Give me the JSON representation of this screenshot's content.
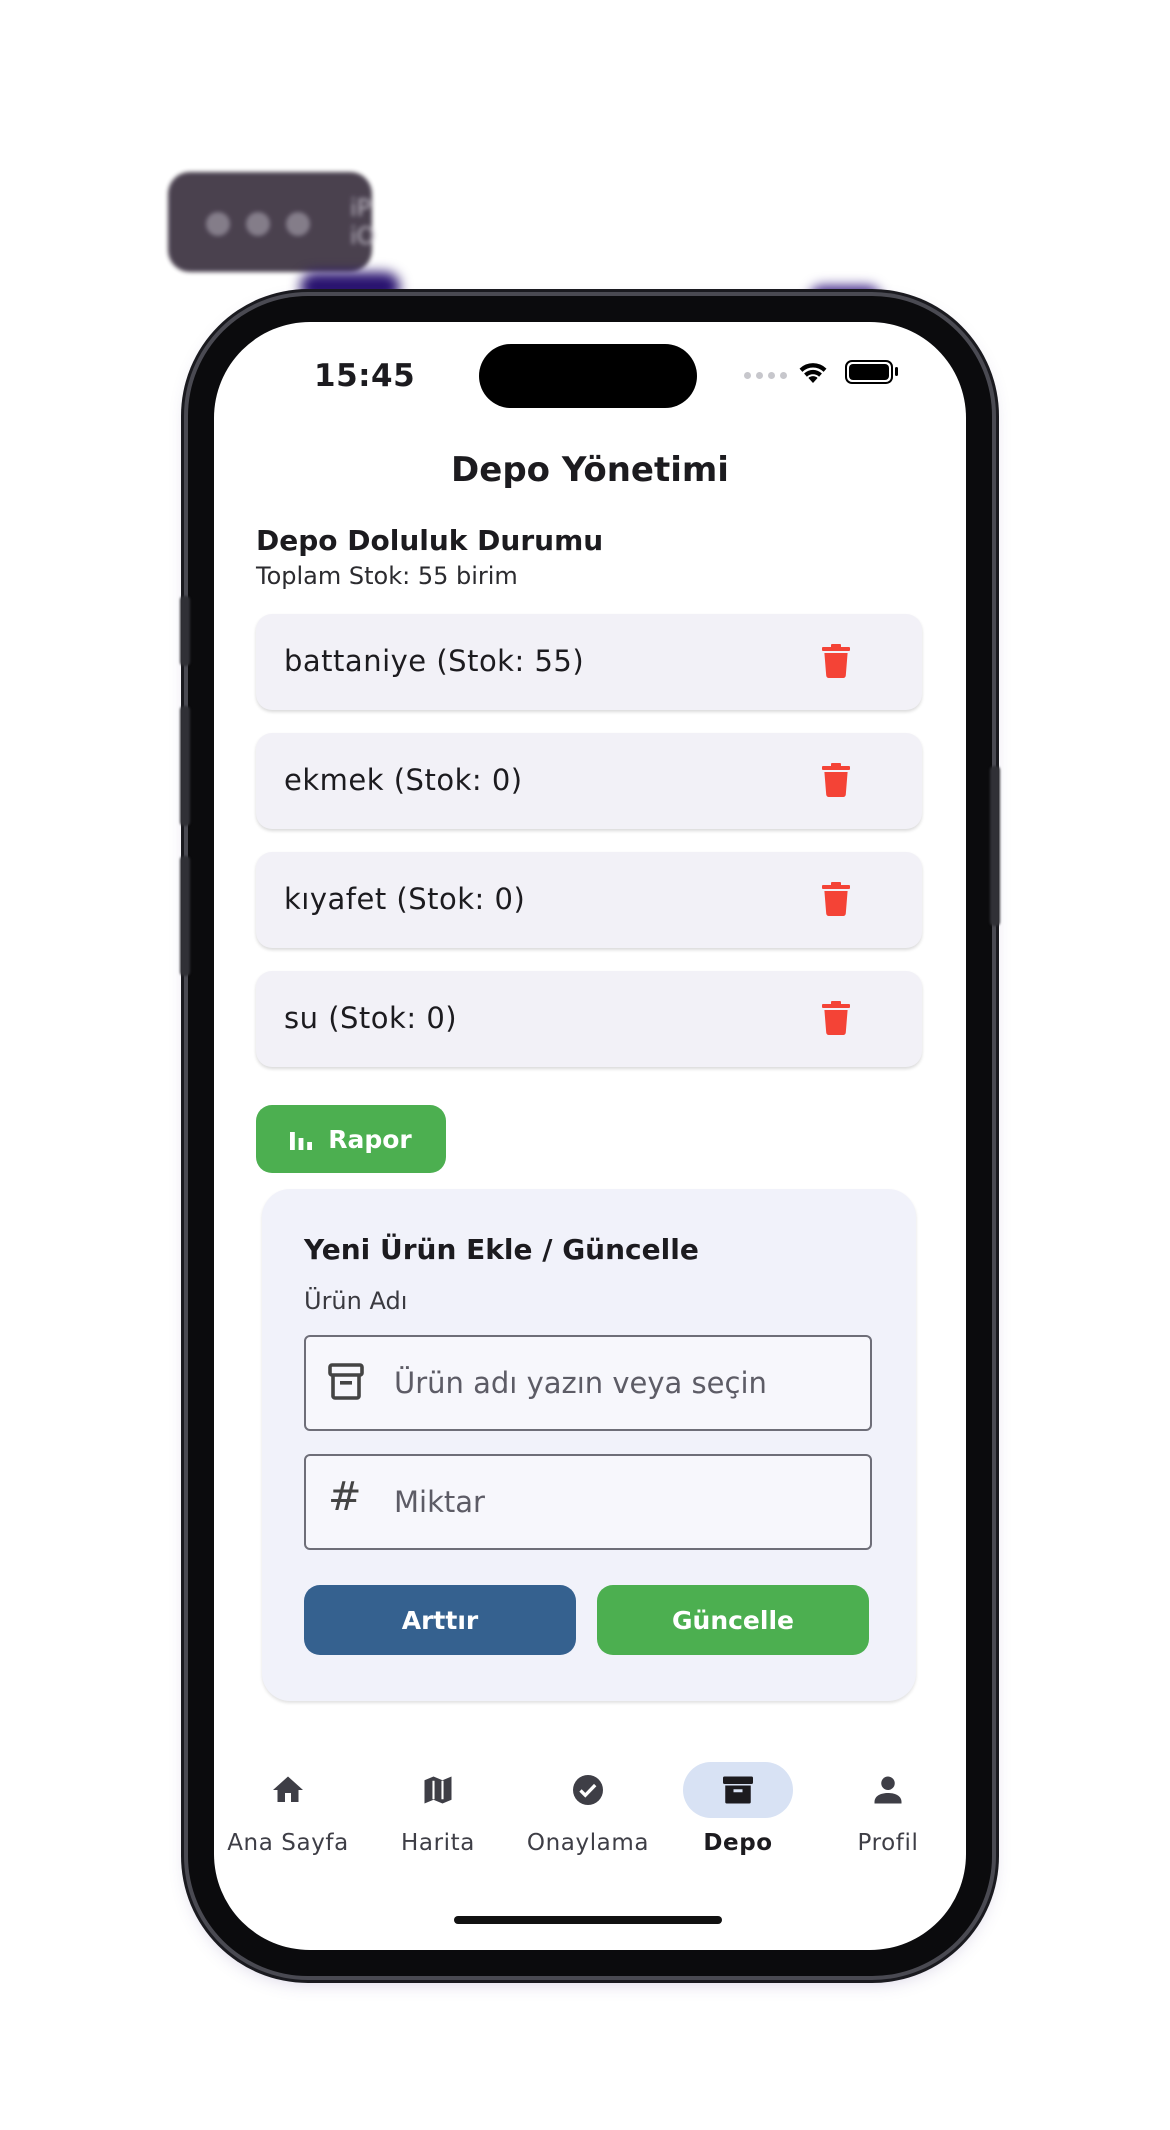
{
  "window_badge": {
    "label_line1": "iP",
    "label_line2": "iO"
  },
  "status_bar": {
    "time": "15:45"
  },
  "header": {
    "title": "Depo Yönetimi"
  },
  "stock_summary": {
    "title": "Depo Doluluk Durumu",
    "subtitle": "Toplam Stok: 55 birim"
  },
  "items": [
    {
      "label": "battaniye (Stok: 55)"
    },
    {
      "label": "ekmek (Stok: 0)"
    },
    {
      "label": "kıyafet (Stok: 0)"
    },
    {
      "label": "su (Stok: 0)"
    }
  ],
  "report_button": {
    "label": "Rapor",
    "icon": "bar-chart-icon"
  },
  "form": {
    "title": "Yeni Ürün Ekle / Güncelle",
    "product_label": "Ürün Adı",
    "product_placeholder": "Ürün adı yazın veya seçin",
    "product_value": "",
    "quantity_placeholder": "Miktar",
    "quantity_value": "",
    "increase_label": "Arttır",
    "update_label": "Güncelle"
  },
  "bottom_nav": [
    {
      "label": "Ana Sayfa",
      "icon": "home-icon",
      "active": false
    },
    {
      "label": "Harita",
      "icon": "map-icon",
      "active": false
    },
    {
      "label": "Onaylama",
      "icon": "check-circle-icon",
      "active": false
    },
    {
      "label": "Depo",
      "icon": "archive-icon",
      "active": true
    },
    {
      "label": "Profil",
      "icon": "person-icon",
      "active": false
    }
  ],
  "colors": {
    "accent_green": "#4caf50",
    "accent_blue": "#35618f",
    "delete_red": "#f44336",
    "card_bg": "#f2f1f7",
    "nav_active": "#d8e2f4"
  }
}
